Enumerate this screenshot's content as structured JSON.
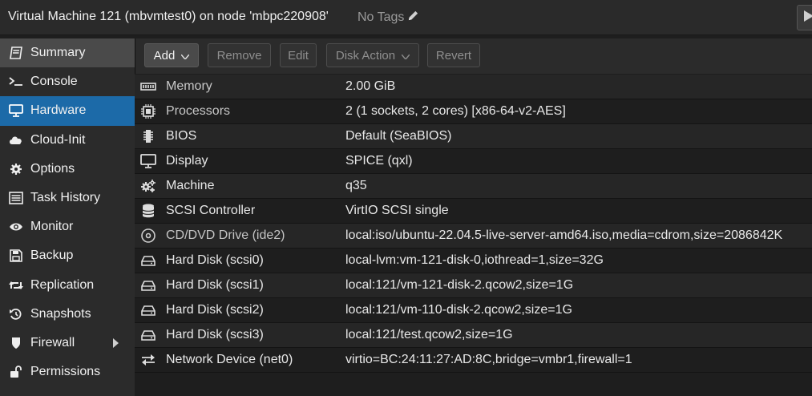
{
  "header": {
    "title": "Virtual Machine 121 (mbvmtest0) on node 'mbpc220908'",
    "tags": "No Tags",
    "icons": [
      "pencil-icon",
      "play-icon"
    ]
  },
  "sidebar": {
    "items": [
      {
        "label": "Summary",
        "icon": "book-icon"
      },
      {
        "label": "Console",
        "icon": "terminal-icon"
      },
      {
        "label": "Hardware",
        "icon": "desktop-icon"
      },
      {
        "label": "Cloud-Init",
        "icon": "cloud-icon"
      },
      {
        "label": "Options",
        "icon": "gear-icon"
      },
      {
        "label": "Task History",
        "icon": "list-icon"
      },
      {
        "label": "Monitor",
        "icon": "eye-icon"
      },
      {
        "label": "Backup",
        "icon": "floppy-icon"
      },
      {
        "label": "Replication",
        "icon": "retweet-icon"
      },
      {
        "label": "Snapshots",
        "icon": "history-icon"
      },
      {
        "label": "Firewall",
        "icon": "shield-icon"
      },
      {
        "label": "Permissions",
        "icon": "unlock-icon"
      }
    ],
    "active": "Hardware"
  },
  "toolbar": {
    "add": "Add",
    "remove": "Remove",
    "edit": "Edit",
    "disk_action": "Disk Action",
    "revert": "Revert"
  },
  "hardware": [
    {
      "label": "Memory",
      "value": "2.00 GiB",
      "icon": "memory-icon"
    },
    {
      "label": "Processors",
      "value": "2 (1 sockets, 2 cores) [x86-64-v2-AES]",
      "icon": "cpu-icon"
    },
    {
      "label": "BIOS",
      "value": "Default (SeaBIOS)",
      "icon": "chip-icon"
    },
    {
      "label": "Display",
      "value": "SPICE (qxl)",
      "icon": "monitor-icon"
    },
    {
      "label": "Machine",
      "value": "q35",
      "icon": "cogs-icon"
    },
    {
      "label": "SCSI Controller",
      "value": "VirtIO SCSI single",
      "icon": "database-icon"
    },
    {
      "label": "CD/DVD Drive (ide2)",
      "value": "local:iso/ubuntu-22.04.5-live-server-amd64.iso,media=cdrom,size=2086842K",
      "icon": "cdrom-icon"
    },
    {
      "label": "Hard Disk (scsi0)",
      "value": "local-lvm:vm-121-disk-0,iothread=1,size=32G",
      "icon": "hdd-icon"
    },
    {
      "label": "Hard Disk (scsi1)",
      "value": "local:121/vm-121-disk-2.qcow2,size=1G",
      "icon": "hdd-icon"
    },
    {
      "label": "Hard Disk (scsi2)",
      "value": "local:121/vm-110-disk-2.qcow2,size=1G",
      "icon": "hdd-icon"
    },
    {
      "label": "Hard Disk (scsi3)",
      "value": "local:121/test.qcow2,size=1G",
      "icon": "hdd-icon"
    },
    {
      "label": "Network Device (net0)",
      "value": "virtio=BC:24:11:27:AD:8C,bridge=vmbr1,firewall=1",
      "icon": "exchange-icon"
    }
  ]
}
